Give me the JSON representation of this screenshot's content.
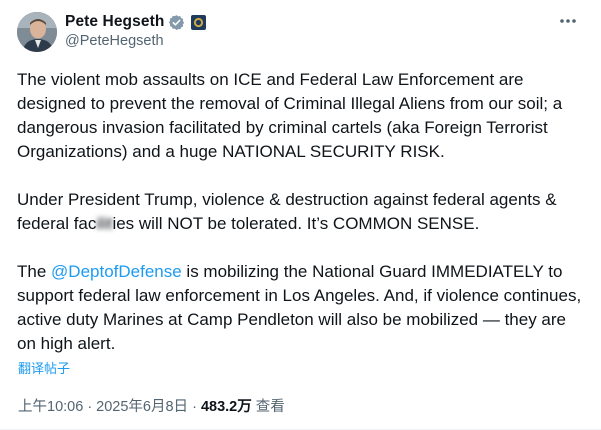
{
  "author": {
    "name": "Pete Hegseth",
    "handle": "@PeteHegseth"
  },
  "paragraphs": {
    "p1": "The violent mob assaults on ICE and Federal Law Enforcement are designed to prevent the removal of Criminal Illegal Aliens from our soil; a dangerous invasion facilitated by criminal cartels (aka Foreign Terrorist Organizations) and a huge NATIONAL SECURITY RISK.",
    "p2_before": "Under President Trump, violence & destruction against federal agents & federal fac",
    "p2_blurred": "ilit",
    "p2_after": "ies will NOT be tolerated. It’s COMMON SENSE.",
    "p3_before": "The ",
    "p3_mention": "@DeptofDefense",
    "p3_after": " is mobilizing the National Guard IMMEDIATELY to support federal law enforcement in Los Angeles. And, if violence continues, active duty Marines at Camp Pendleton will also be mobilized — they are on high alert."
  },
  "translate_label": "翻译帖子",
  "meta": {
    "time_date": "上午10:06 · 2025年6月8日 · ",
    "views_count": "483.2万",
    "views_label": " 查看"
  },
  "colors": {
    "accent": "#1d9bf0",
    "text": "#0f1419",
    "secondary": "#536471"
  }
}
